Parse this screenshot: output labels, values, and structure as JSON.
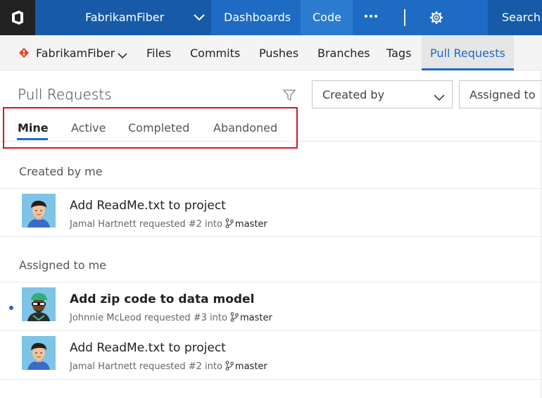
{
  "topbar": {
    "project": "FabrikamFiber",
    "nav": [
      "Dashboards",
      "Code"
    ],
    "more_icon": "ellipsis-icon",
    "settings_icon": "gear-icon",
    "search_label": "Search"
  },
  "subnav": {
    "repo": "FabrikamFiber",
    "items": [
      "Files",
      "Commits",
      "Pushes",
      "Branches",
      "Tags",
      "Pull Requests"
    ],
    "active": "Pull Requests"
  },
  "header": {
    "title": "Pull Requests",
    "filter_icon": "filter-icon",
    "created_by_label": "Created by",
    "assigned_to_label": "Assigned to"
  },
  "tabs": {
    "items": [
      "Mine",
      "Active",
      "Completed",
      "Abandoned"
    ],
    "active": "Mine"
  },
  "sections": [
    {
      "header": "Created by me",
      "rows": [
        {
          "title": "Add ReadMe.txt to project",
          "meta": "Jamal Hartnett requested #2 into",
          "branch": "master",
          "bold": false,
          "unread": false
        }
      ]
    },
    {
      "header": "Assigned to me",
      "rows": [
        {
          "title": "Add zip code to data model",
          "meta": "Johnnie McLeod requested #3 into",
          "branch": "master",
          "bold": true,
          "unread": true
        },
        {
          "title": "Add ReadMe.txt to project",
          "meta": "Jamal Hartnett requested #2 into",
          "branch": "master",
          "bold": false,
          "unread": false
        }
      ]
    }
  ],
  "colors": {
    "accent": "#1e6bc3",
    "topbar": "#1e6bc3",
    "highlight_box": "#d9151c"
  }
}
